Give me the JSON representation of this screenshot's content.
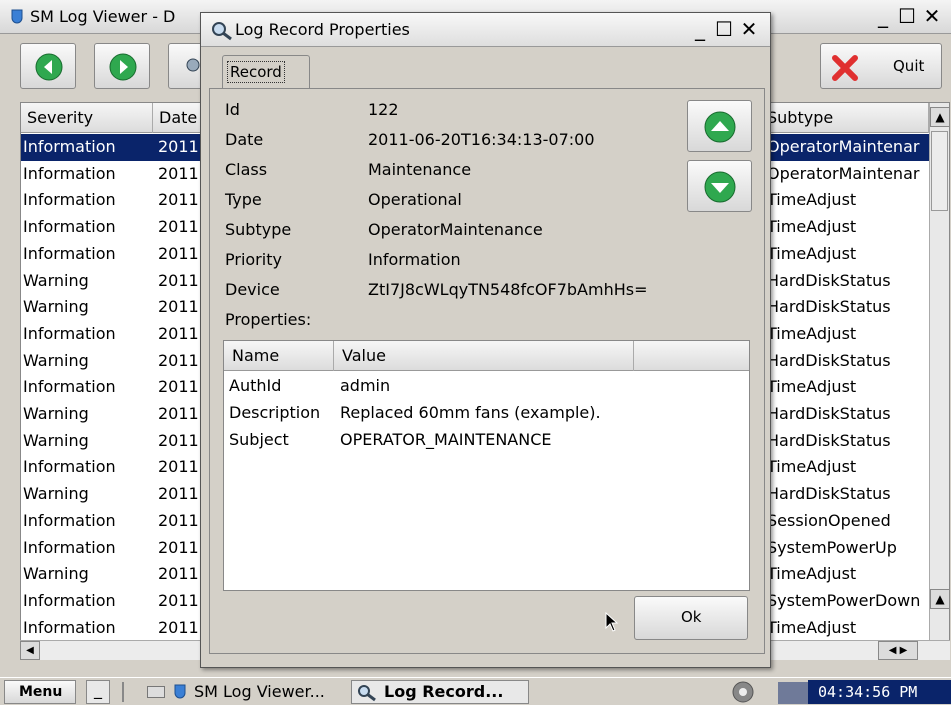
{
  "main_window": {
    "title": "SM Log Viewer - D",
    "quit_label": "Quit",
    "columns": [
      "Severity",
      "Date",
      "Subtype"
    ],
    "rows": [
      {
        "severity": "Information",
        "date": "2011",
        "subtype": "OperatorMaintenar",
        "selected": true
      },
      {
        "severity": "Information",
        "date": "2011",
        "subtype": "OperatorMaintenar"
      },
      {
        "severity": "Information",
        "date": "2011",
        "subtype": "TimeAdjust"
      },
      {
        "severity": "Information",
        "date": "2011",
        "subtype": "TimeAdjust"
      },
      {
        "severity": "Information",
        "date": "2011",
        "subtype": "TimeAdjust"
      },
      {
        "severity": "Warning",
        "date": "2011",
        "subtype": "HardDiskStatus"
      },
      {
        "severity": "Warning",
        "date": "2011",
        "subtype": "HardDiskStatus"
      },
      {
        "severity": "Information",
        "date": "2011",
        "subtype": "TimeAdjust"
      },
      {
        "severity": "Warning",
        "date": "2011",
        "subtype": "HardDiskStatus"
      },
      {
        "severity": "Information",
        "date": "2011",
        "subtype": "TimeAdjust"
      },
      {
        "severity": "Warning",
        "date": "2011",
        "subtype": "HardDiskStatus"
      },
      {
        "severity": "Warning",
        "date": "2011",
        "subtype": "HardDiskStatus"
      },
      {
        "severity": "Information",
        "date": "2011",
        "subtype": "TimeAdjust"
      },
      {
        "severity": "Warning",
        "date": "2011",
        "subtype": "HardDiskStatus"
      },
      {
        "severity": "Information",
        "date": "2011",
        "subtype": "SessionOpened"
      },
      {
        "severity": "Information",
        "date": "2011",
        "subtype": "SystemPowerUp"
      },
      {
        "severity": "Warning",
        "date": "2011",
        "subtype": "TimeAdjust"
      },
      {
        "severity": "Information",
        "date": "2011",
        "subtype": "SystemPowerDown"
      },
      {
        "severity": "Information",
        "date": "2011",
        "subtype": "TimeAdjust"
      }
    ]
  },
  "dialog": {
    "title": "Log Record Properties",
    "tab_label": "Record",
    "fields": [
      {
        "label": "Id",
        "value": "122"
      },
      {
        "label": "Date",
        "value": "2011-06-20T16:34:13-07:00"
      },
      {
        "label": "Class",
        "value": "Maintenance"
      },
      {
        "label": "Type",
        "value": "Operational"
      },
      {
        "label": "Subtype",
        "value": "OperatorMaintenance"
      },
      {
        "label": "Priority",
        "value": "Information"
      },
      {
        "label": "Device",
        "value": "ZtI7J8cWLqyTN548fcOF7bAmhHs="
      }
    ],
    "properties_label": "Properties:",
    "properties_columns": [
      "Name",
      "Value"
    ],
    "properties_rows": [
      {
        "name": "AuthId",
        "value": "admin"
      },
      {
        "name": "Description",
        "value": "Replaced 60mm fans (example)."
      },
      {
        "name": "Subject",
        "value": "OPERATOR_MAINTENANCE"
      }
    ],
    "ok_label": "Ok"
  },
  "taskbar": {
    "menu_label": "Menu",
    "show_desktop_label": "_",
    "tasks": [
      "SM Log Viewer...",
      "Log Record..."
    ],
    "clock": "04:34:56 PM"
  },
  "colors": {
    "selection": "#0a246a",
    "nav_green": "#2fa84f",
    "quit_red": "#e03030"
  }
}
